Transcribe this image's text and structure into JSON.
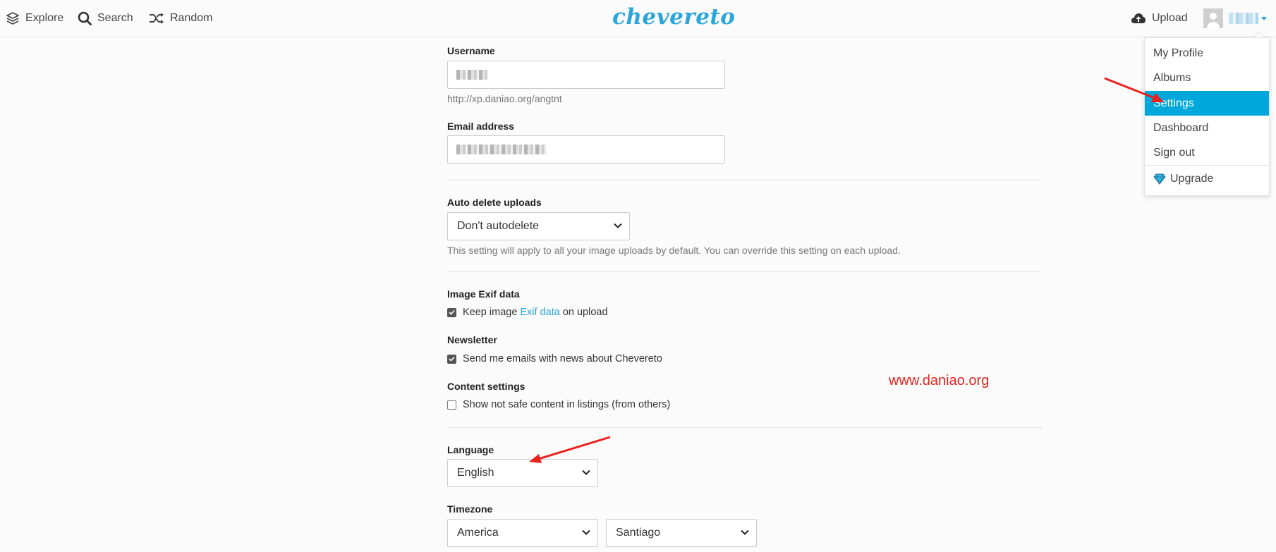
{
  "nav": {
    "explore": "Explore",
    "search": "Search",
    "random": "Random",
    "logo": "chevereto",
    "upload": "Upload"
  },
  "user_menu": {
    "items": [
      "My Profile",
      "Albums",
      "Settings",
      "Dashboard",
      "Sign out"
    ],
    "active": "Settings",
    "upgrade": "Upgrade"
  },
  "form": {
    "username_label": "Username",
    "username_hint": "http://xp.daniao.org/angtnt",
    "email_label": "Email address",
    "auto_delete_label": "Auto delete uploads",
    "auto_delete_value": "Don't autodelete",
    "auto_delete_help": "This setting will apply to all your image uploads by default. You can override this setting on each upload.",
    "exif_label": "Image Exif data",
    "exif_text_before": "Keep image",
    "exif_link": "Exif data",
    "exif_text_after": "on upload",
    "exif_checked": true,
    "newsletter_label": "Newsletter",
    "newsletter_text": "Send me emails with news about Chevereto",
    "newsletter_checked": true,
    "content_label": "Content settings",
    "content_text": "Show not safe content in listings (from others)",
    "content_checked": false,
    "language_label": "Language",
    "language_value": "English",
    "timezone_label": "Timezone",
    "timezone_region": "America",
    "timezone_city": "Santiago"
  },
  "watermark": "www.daniao.org",
  "colors": {
    "accent": "#2aa6da",
    "menu_active": "#00a7da",
    "annotation": "#e8231e"
  }
}
